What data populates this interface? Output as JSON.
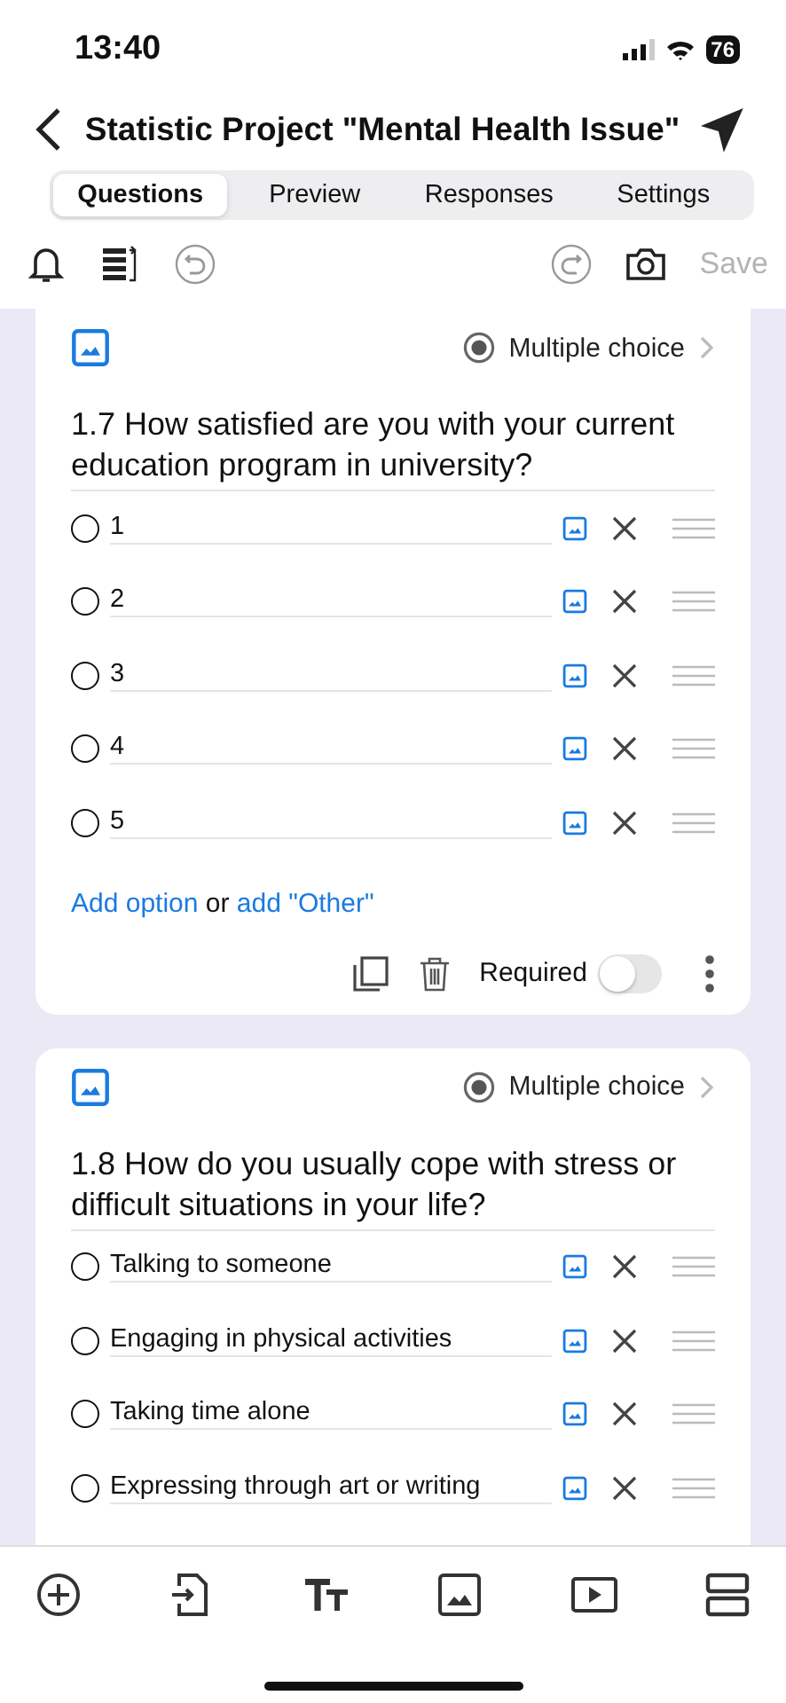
{
  "status_bar": {
    "time": "13:40",
    "battery": "76"
  },
  "header": {
    "title": "Statistic Project \"Mental Health Issue\""
  },
  "tabs": [
    {
      "label": "Questions",
      "selected": true
    },
    {
      "label": "Preview",
      "selected": false
    },
    {
      "label": "Responses",
      "selected": false
    },
    {
      "label": "Settings",
      "selected": false
    }
  ],
  "toolbar": {
    "save_label": "Save",
    "save_disabled": true
  },
  "questions": [
    {
      "type_label": "Multiple choice",
      "text": "1.7 How satisfied are you with your current education program in university?",
      "options": [
        {
          "label": "1"
        },
        {
          "label": "2"
        },
        {
          "label": "3"
        },
        {
          "label": "4"
        },
        {
          "label": "5"
        }
      ],
      "footer": {
        "add_option": "Add option",
        "or": "or",
        "add_other": "add \"Other\"",
        "required_label": "Required",
        "required": false
      }
    },
    {
      "type_label": "Multiple choice",
      "text": "1.8 How do you usually cope with stress or difficult situations in your life?",
      "options": [
        {
          "label": "Talking to someone"
        },
        {
          "label": "Engaging in physical activities"
        },
        {
          "label": "Taking time alone"
        },
        {
          "label": "Expressing through art or writing"
        }
      ]
    }
  ]
}
